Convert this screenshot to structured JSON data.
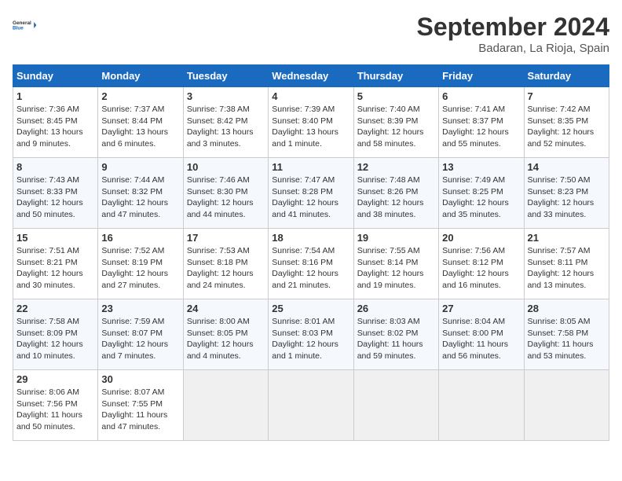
{
  "header": {
    "logo_line1": "General",
    "logo_line2": "Blue",
    "month": "September 2024",
    "location": "Badaran, La Rioja, Spain"
  },
  "days_of_week": [
    "Sunday",
    "Monday",
    "Tuesday",
    "Wednesday",
    "Thursday",
    "Friday",
    "Saturday"
  ],
  "weeks": [
    [
      {
        "day": 1,
        "lines": [
          "Sunrise: 7:36 AM",
          "Sunset: 8:45 PM",
          "Daylight: 13 hours",
          "and 9 minutes."
        ]
      },
      {
        "day": 2,
        "lines": [
          "Sunrise: 7:37 AM",
          "Sunset: 8:44 PM",
          "Daylight: 13 hours",
          "and 6 minutes."
        ]
      },
      {
        "day": 3,
        "lines": [
          "Sunrise: 7:38 AM",
          "Sunset: 8:42 PM",
          "Daylight: 13 hours",
          "and 3 minutes."
        ]
      },
      {
        "day": 4,
        "lines": [
          "Sunrise: 7:39 AM",
          "Sunset: 8:40 PM",
          "Daylight: 13 hours",
          "and 1 minute."
        ]
      },
      {
        "day": 5,
        "lines": [
          "Sunrise: 7:40 AM",
          "Sunset: 8:39 PM",
          "Daylight: 12 hours",
          "and 58 minutes."
        ]
      },
      {
        "day": 6,
        "lines": [
          "Sunrise: 7:41 AM",
          "Sunset: 8:37 PM",
          "Daylight: 12 hours",
          "and 55 minutes."
        ]
      },
      {
        "day": 7,
        "lines": [
          "Sunrise: 7:42 AM",
          "Sunset: 8:35 PM",
          "Daylight: 12 hours",
          "and 52 minutes."
        ]
      }
    ],
    [
      {
        "day": 8,
        "lines": [
          "Sunrise: 7:43 AM",
          "Sunset: 8:33 PM",
          "Daylight: 12 hours",
          "and 50 minutes."
        ]
      },
      {
        "day": 9,
        "lines": [
          "Sunrise: 7:44 AM",
          "Sunset: 8:32 PM",
          "Daylight: 12 hours",
          "and 47 minutes."
        ]
      },
      {
        "day": 10,
        "lines": [
          "Sunrise: 7:46 AM",
          "Sunset: 8:30 PM",
          "Daylight: 12 hours",
          "and 44 minutes."
        ]
      },
      {
        "day": 11,
        "lines": [
          "Sunrise: 7:47 AM",
          "Sunset: 8:28 PM",
          "Daylight: 12 hours",
          "and 41 minutes."
        ]
      },
      {
        "day": 12,
        "lines": [
          "Sunrise: 7:48 AM",
          "Sunset: 8:26 PM",
          "Daylight: 12 hours",
          "and 38 minutes."
        ]
      },
      {
        "day": 13,
        "lines": [
          "Sunrise: 7:49 AM",
          "Sunset: 8:25 PM",
          "Daylight: 12 hours",
          "and 35 minutes."
        ]
      },
      {
        "day": 14,
        "lines": [
          "Sunrise: 7:50 AM",
          "Sunset: 8:23 PM",
          "Daylight: 12 hours",
          "and 33 minutes."
        ]
      }
    ],
    [
      {
        "day": 15,
        "lines": [
          "Sunrise: 7:51 AM",
          "Sunset: 8:21 PM",
          "Daylight: 12 hours",
          "and 30 minutes."
        ]
      },
      {
        "day": 16,
        "lines": [
          "Sunrise: 7:52 AM",
          "Sunset: 8:19 PM",
          "Daylight: 12 hours",
          "and 27 minutes."
        ]
      },
      {
        "day": 17,
        "lines": [
          "Sunrise: 7:53 AM",
          "Sunset: 8:18 PM",
          "Daylight: 12 hours",
          "and 24 minutes."
        ]
      },
      {
        "day": 18,
        "lines": [
          "Sunrise: 7:54 AM",
          "Sunset: 8:16 PM",
          "Daylight: 12 hours",
          "and 21 minutes."
        ]
      },
      {
        "day": 19,
        "lines": [
          "Sunrise: 7:55 AM",
          "Sunset: 8:14 PM",
          "Daylight: 12 hours",
          "and 19 minutes."
        ]
      },
      {
        "day": 20,
        "lines": [
          "Sunrise: 7:56 AM",
          "Sunset: 8:12 PM",
          "Daylight: 12 hours",
          "and 16 minutes."
        ]
      },
      {
        "day": 21,
        "lines": [
          "Sunrise: 7:57 AM",
          "Sunset: 8:11 PM",
          "Daylight: 12 hours",
          "and 13 minutes."
        ]
      }
    ],
    [
      {
        "day": 22,
        "lines": [
          "Sunrise: 7:58 AM",
          "Sunset: 8:09 PM",
          "Daylight: 12 hours",
          "and 10 minutes."
        ]
      },
      {
        "day": 23,
        "lines": [
          "Sunrise: 7:59 AM",
          "Sunset: 8:07 PM",
          "Daylight: 12 hours",
          "and 7 minutes."
        ]
      },
      {
        "day": 24,
        "lines": [
          "Sunrise: 8:00 AM",
          "Sunset: 8:05 PM",
          "Daylight: 12 hours",
          "and 4 minutes."
        ]
      },
      {
        "day": 25,
        "lines": [
          "Sunrise: 8:01 AM",
          "Sunset: 8:03 PM",
          "Daylight: 12 hours",
          "and 1 minute."
        ]
      },
      {
        "day": 26,
        "lines": [
          "Sunrise: 8:03 AM",
          "Sunset: 8:02 PM",
          "Daylight: 11 hours",
          "and 59 minutes."
        ]
      },
      {
        "day": 27,
        "lines": [
          "Sunrise: 8:04 AM",
          "Sunset: 8:00 PM",
          "Daylight: 11 hours",
          "and 56 minutes."
        ]
      },
      {
        "day": 28,
        "lines": [
          "Sunrise: 8:05 AM",
          "Sunset: 7:58 PM",
          "Daylight: 11 hours",
          "and 53 minutes."
        ]
      }
    ],
    [
      {
        "day": 29,
        "lines": [
          "Sunrise: 8:06 AM",
          "Sunset: 7:56 PM",
          "Daylight: 11 hours",
          "and 50 minutes."
        ]
      },
      {
        "day": 30,
        "lines": [
          "Sunrise: 8:07 AM",
          "Sunset: 7:55 PM",
          "Daylight: 11 hours",
          "and 47 minutes."
        ]
      },
      {
        "day": null,
        "lines": []
      },
      {
        "day": null,
        "lines": []
      },
      {
        "day": null,
        "lines": []
      },
      {
        "day": null,
        "lines": []
      },
      {
        "day": null,
        "lines": []
      }
    ]
  ]
}
